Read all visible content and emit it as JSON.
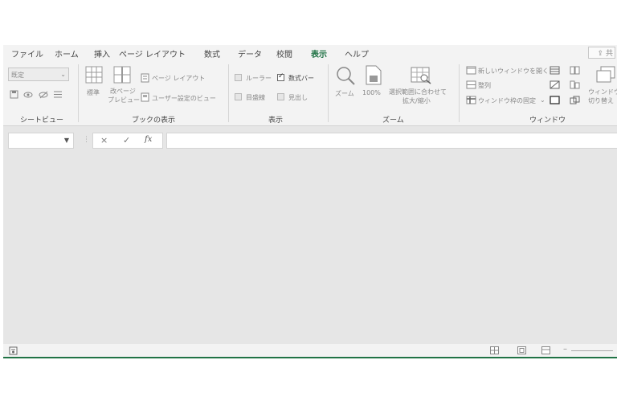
{
  "accent": "#217346",
  "tabs": [
    "ファイル",
    "ホーム",
    "挿入",
    "ページ レイアウト",
    "数式",
    "データ",
    "校閲",
    "表示",
    "ヘルプ"
  ],
  "active_tab": "表示",
  "share_label": "共",
  "sheet_view": {
    "select_value": "既定",
    "group_label": "シートビュー"
  },
  "book_view": {
    "normal": "標準",
    "page_break_line1": "改ページ",
    "page_break_line2": "プレビュー",
    "page_layout": "ページ レイアウト",
    "custom_view": "ユーザー設定のビュー",
    "group_label": "ブックの表示"
  },
  "show": {
    "ruler": "ルーラー",
    "formula_bar": "数式バー",
    "gridlines": "目盛線",
    "headings": "見出し",
    "formula_bar_checked": true,
    "group_label": "表示"
  },
  "zoom": {
    "zoom": "ズーム",
    "hundred": "100%",
    "selection_line1": "選択範囲に合わせて",
    "selection_line2": "拡大/縮小",
    "group_label": "ズーム"
  },
  "window": {
    "new_window": "新しいウィンドウを開く",
    "arrange": "整列",
    "freeze": "ウィンドウ枠の固定",
    "switch_line1": "ウィンドウの",
    "switch_line2": "切り替え",
    "group_label": "ウィンドウ"
  },
  "formula_bar": {
    "cancel": "×",
    "enter": "✓",
    "fx": "fx"
  }
}
